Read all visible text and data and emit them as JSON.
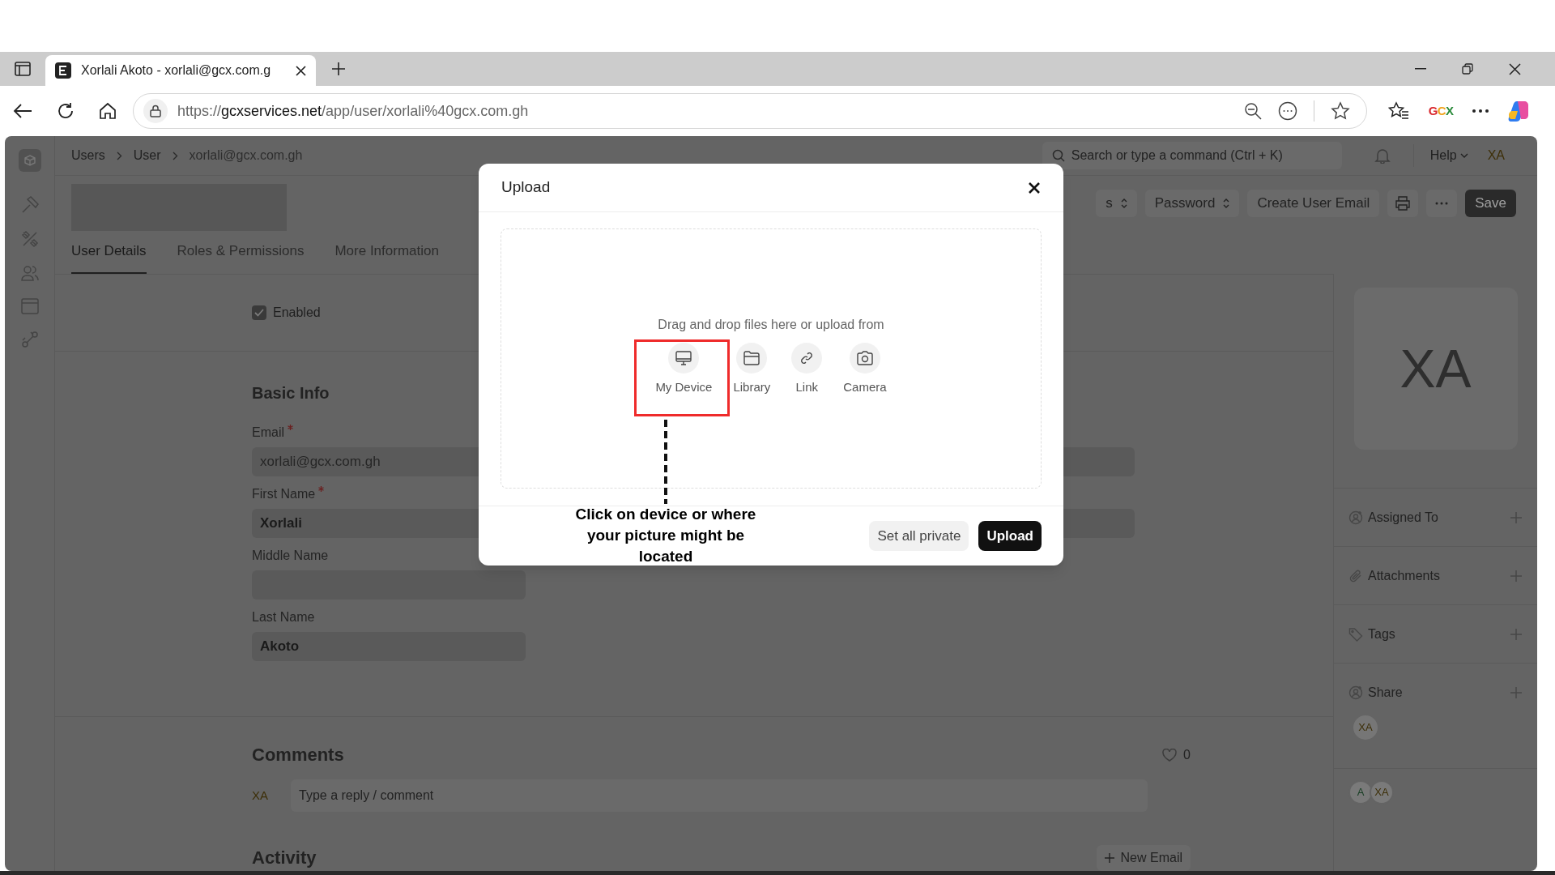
{
  "browser": {
    "tab_title": "Xorlali Akoto - xorlali@gcx.com.g",
    "url_scheme": "https://",
    "url_host": "gcxservices.net",
    "url_path": "/app/user/xorlali%40gcx.com.gh",
    "extension_label": "GCX"
  },
  "app": {
    "breadcrumbs": [
      {
        "label": "Users"
      },
      {
        "label": "User"
      },
      {
        "label": "xorlali@gcx.com.gh"
      }
    ],
    "search": {
      "placeholder": "Search or type a command (Ctrl + K)"
    },
    "help": "Help",
    "user_initials": "XA",
    "toolbar": [
      {
        "kind": "dropdown",
        "label": "s"
      },
      {
        "kind": "dropdown",
        "label": "Password"
      },
      {
        "kind": "button",
        "label": "Create User Email"
      },
      {
        "kind": "print"
      },
      {
        "kind": "more"
      },
      {
        "kind": "primary",
        "label": "Save"
      }
    ],
    "tabs": [
      {
        "label": "User Details",
        "selected": true
      },
      {
        "label": "Roles & Permissions",
        "selected": false
      },
      {
        "label": "More Information",
        "selected": false
      }
    ],
    "enabled": {
      "label": "Enabled",
      "checked": true
    },
    "section_title": "Basic Info",
    "fields": [
      {
        "label": "Email",
        "required": true,
        "value": "xorlali@gcx.com.gh",
        "read_only": true
      },
      {
        "label": "First Name",
        "required": true,
        "value": "Xorlali",
        "read_only": false
      },
      {
        "label": "Middle Name",
        "required": false
      },
      {
        "label": "Last Name",
        "required": false,
        "value": "Akoto",
        "read_only": false
      }
    ],
    "comments": {
      "title": "Comments",
      "likes": "0",
      "avatar": "XA",
      "placeholder": "Type a reply / comment"
    },
    "activity": {
      "title": "Activity",
      "new_email": "New Email"
    },
    "side": {
      "avatar": "XA",
      "sections": [
        {
          "kind": "assign",
          "label": "Assigned To"
        },
        {
          "kind": "attach",
          "label": "Attachments"
        },
        {
          "kind": "tag",
          "label": "Tags"
        },
        {
          "kind": "share",
          "label": "Share"
        }
      ],
      "shared_with": "XA",
      "viewers": [
        {
          "initials": "A",
          "color": "#163d22"
        },
        {
          "initials": "XA",
          "color": "#3d2f08"
        }
      ]
    }
  },
  "modal": {
    "title": "Upload",
    "drop_text": "Drag and drop files here or upload from",
    "sources": [
      {
        "kind": "device",
        "label": "My Device"
      },
      {
        "kind": "library",
        "label": "Library"
      },
      {
        "kind": "link",
        "label": "Link"
      },
      {
        "kind": "camera",
        "label": "Camera"
      }
    ],
    "buttons": [
      {
        "kind": "secondary",
        "label": "Set all private"
      },
      {
        "kind": "primary",
        "label": "Upload"
      }
    ]
  },
  "annotation": {
    "text": "Click on device or where your picture might be located"
  }
}
